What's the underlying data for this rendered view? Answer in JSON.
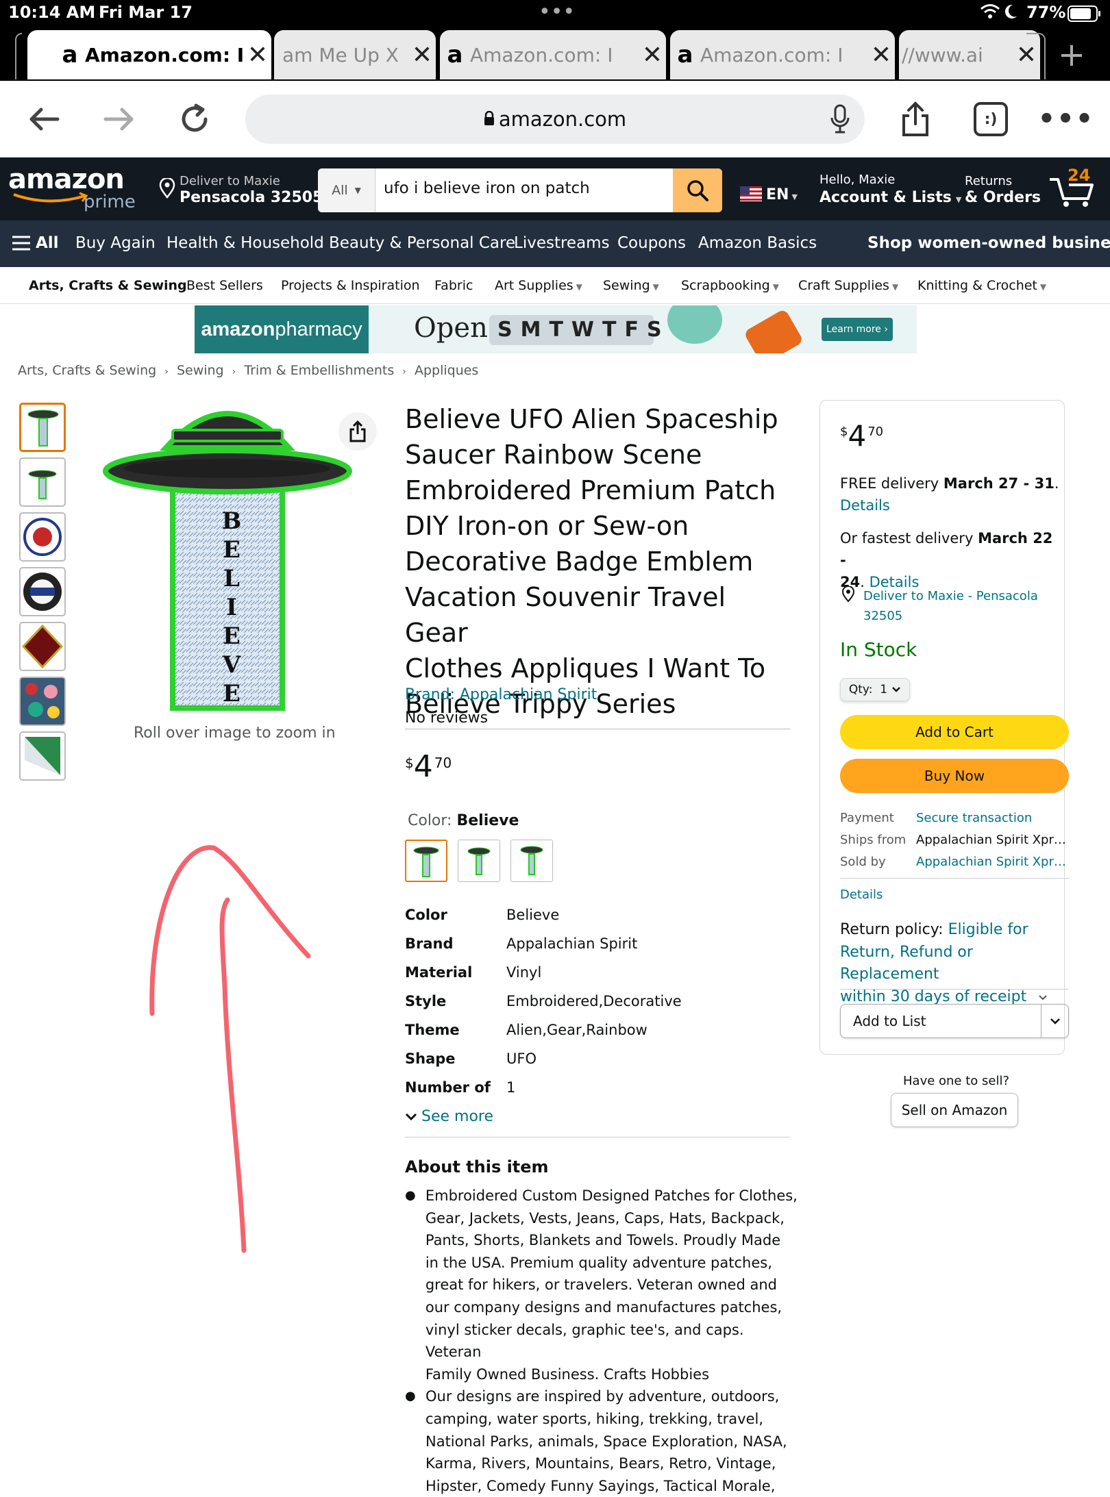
{
  "status": {
    "time": "10:14 AM",
    "date": "Fri Mar 17",
    "dots": "•••",
    "battery": "77%"
  },
  "tabs": [
    {
      "label": "Amazon.com: I",
      "favicon": "a",
      "active": true
    },
    {
      "label": "am Me Up X",
      "favicon": "",
      "active": false
    },
    {
      "label": "Amazon.com: I",
      "favicon": "a",
      "active": false
    },
    {
      "label": "Amazon.com: I",
      "favicon": "a",
      "active": false
    },
    {
      "label": "//www.ai",
      "favicon": "",
      "active": false
    }
  ],
  "browser": {
    "url": "amazon.com",
    "tab_button": ":)"
  },
  "header": {
    "logo": "amazon",
    "logo_prime": "prime",
    "deliver_line1": "Deliver to Maxie",
    "deliver_line2": "Pensacola 32505",
    "search_category": "All",
    "search_value": "ufo i believe iron on patch",
    "lang": "EN",
    "account_line1": "Hello, Maxie",
    "account_line2": "Account & Lists",
    "returns_line1": "Returns",
    "returns_line2": "& Orders",
    "cart_count": "24"
  },
  "nav": {
    "all": "All",
    "items": [
      "Buy Again",
      "Health & Household",
      "Beauty & Personal Care",
      "Livestreams",
      "Coupons",
      "Amazon Basics"
    ],
    "right": "Shop women-owned businesses"
  },
  "subnav": {
    "items": [
      "Arts, Crafts & Sewing",
      "Best Sellers",
      "Projects & Inspiration",
      "Fabric",
      "Art Supplies",
      "Sewing",
      "Scrapbooking",
      "Craft Supplies",
      "Knitting & Crochet"
    ]
  },
  "banner": {
    "brand_a": "amazon",
    "brand_b": " pharmacy",
    "open": "Open",
    "days": "SMTWTFS",
    "learn": "Learn more ›"
  },
  "breadcrumb": [
    "Arts, Crafts & Sewing",
    "Sewing",
    "Trim & Embellishments",
    "Appliques"
  ],
  "product": {
    "title_lines": [
      "Believe UFO Alien Spaceship",
      "Saucer Rainbow Scene",
      "Embroidered Premium Patch",
      "DIY Iron-on or Sew-on",
      "Decorative Badge Emblem",
      "Vacation Souvenir Travel Gear",
      "Clothes Appliques I Want To",
      "Believe Trippy Series"
    ],
    "brand_link": "Brand: Appalachian Spirit",
    "reviews": "No reviews",
    "price_symbol": "$",
    "price_whole": "4",
    "price_fraction": "70",
    "color_label": "Color:",
    "color_value": "Believe",
    "patch_word": "BELIEVE",
    "zoom_hint": "Roll over image to zoom in",
    "specs": [
      {
        "k": "Color",
        "v": "Believe"
      },
      {
        "k": "Brand",
        "v": "Appalachian Spirit"
      },
      {
        "k": "Material",
        "v": "Vinyl"
      },
      {
        "k": "Style",
        "v": "Embroidered,Decorative"
      },
      {
        "k": "Theme",
        "v": "Alien,Gear,Rainbow"
      },
      {
        "k": "Shape",
        "v": "UFO"
      },
      {
        "k": "Number of",
        "v": "1"
      }
    ],
    "see_more": "See more",
    "about_title": "About this item",
    "about_1": [
      "Embroidered Custom Designed Patches for Clothes,",
      "Gear, Jackets, Vests, Jeans, Caps, Hats, Backpack,",
      "Pants, Shorts, Blankets and Towels. Proudly Made",
      "in the USA. Premium quality adventure patches,",
      "great for hikers, or travelers. Veteran owned and",
      "our company designs and manufactures patches,",
      "vinyl sticker decals, graphic tee's, and caps. Veteran",
      "Family Owned Business. Crafts Hobbies"
    ],
    "about_2": [
      "Our designs are inspired by adventure, outdoors,",
      "camping, water sports, hiking, trekking, travel,",
      "National Parks, animals, Space Exploration, NASA,",
      "Karma, Rivers, Mountains, Bears, Retro, Vintage,",
      "Hipster, Comedy Funny Sayings, Tactical Morale,"
    ]
  },
  "buybox": {
    "free_a": "FREE delivery ",
    "free_b": "March 27 - 31",
    "free_c": ".",
    "details": "Details",
    "fast_a": "Or fastest delivery ",
    "fast_b": "March 22 -",
    "fast_c": "24",
    "deliver_1": "Deliver to Maxie - Pensacola",
    "deliver_2": "32505",
    "stock": "In Stock",
    "qty": "Qty:  1",
    "add_to_cart": "Add to Cart",
    "buy_now": "Buy Now",
    "payment_k": "Payment",
    "payment_v": "Secure transaction",
    "ships_k": "Ships from",
    "ships_v": "Appalachian Spirit Xpr…",
    "sold_k": "Sold by",
    "sold_v": "Appalachian Spirit Xpr…",
    "details2": "Details",
    "return_k": "Return policy: ",
    "return_l1": "Eligible for",
    "return_l2": "Return, Refund or Replacement",
    "return_l3": "within 30 days of receipt",
    "add_to_list": "Add to List",
    "have_one": "Have one to sell?",
    "sell": "Sell on Amazon"
  },
  "colors": {
    "amazon_dark": "#131921",
    "amazon_nav": "#232f3e",
    "link": "#007185",
    "stock_green": "#007600",
    "cart_yellow": "#ffd814",
    "buy_orange": "#ffa41c",
    "annotation_arrow": "#f4646e"
  }
}
